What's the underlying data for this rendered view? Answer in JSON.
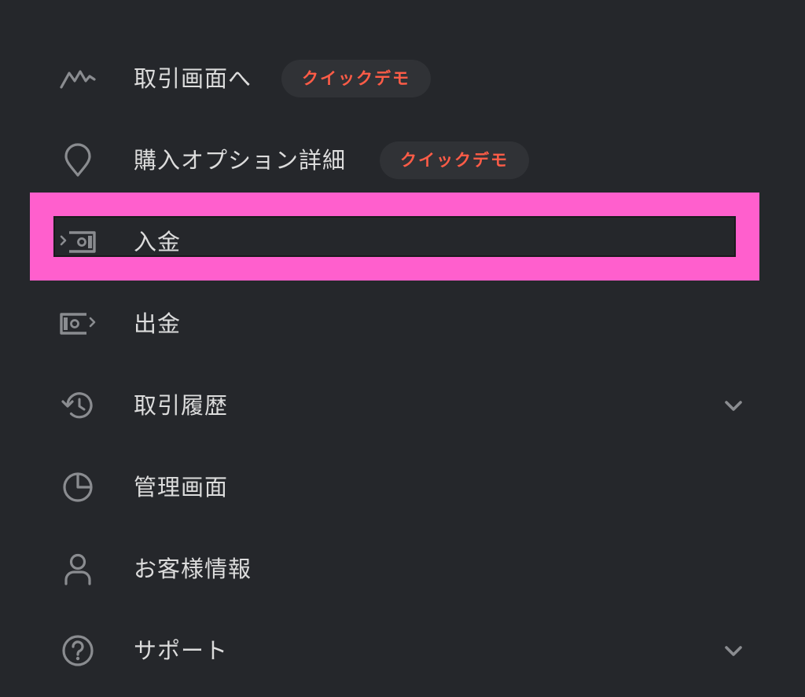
{
  "menu": {
    "items": [
      {
        "label": "取引画面へ",
        "badge": "クイックデモ",
        "icon": "chart-line-icon"
      },
      {
        "label": "購入オプション詳細",
        "badge": "クイックデモ",
        "icon": "map-pin-icon"
      },
      {
        "label": "入金",
        "icon": "deposit-icon"
      },
      {
        "label": "出金",
        "icon": "withdraw-icon"
      },
      {
        "label": "取引履歴",
        "icon": "history-icon",
        "expandable": true
      },
      {
        "label": "管理画面",
        "icon": "pie-chart-icon"
      },
      {
        "label": "お客様情報",
        "icon": "user-icon"
      },
      {
        "label": "サポート",
        "icon": "help-circle-icon",
        "expandable": true
      }
    ],
    "highlighted_item": "入金"
  },
  "colors": {
    "background": "#25272b",
    "text": "#dcdcdc",
    "icon": "#8a8c90",
    "badge_background": "#303236",
    "badge_text": "#ff5c47",
    "highlight": "#ff5fcd"
  }
}
